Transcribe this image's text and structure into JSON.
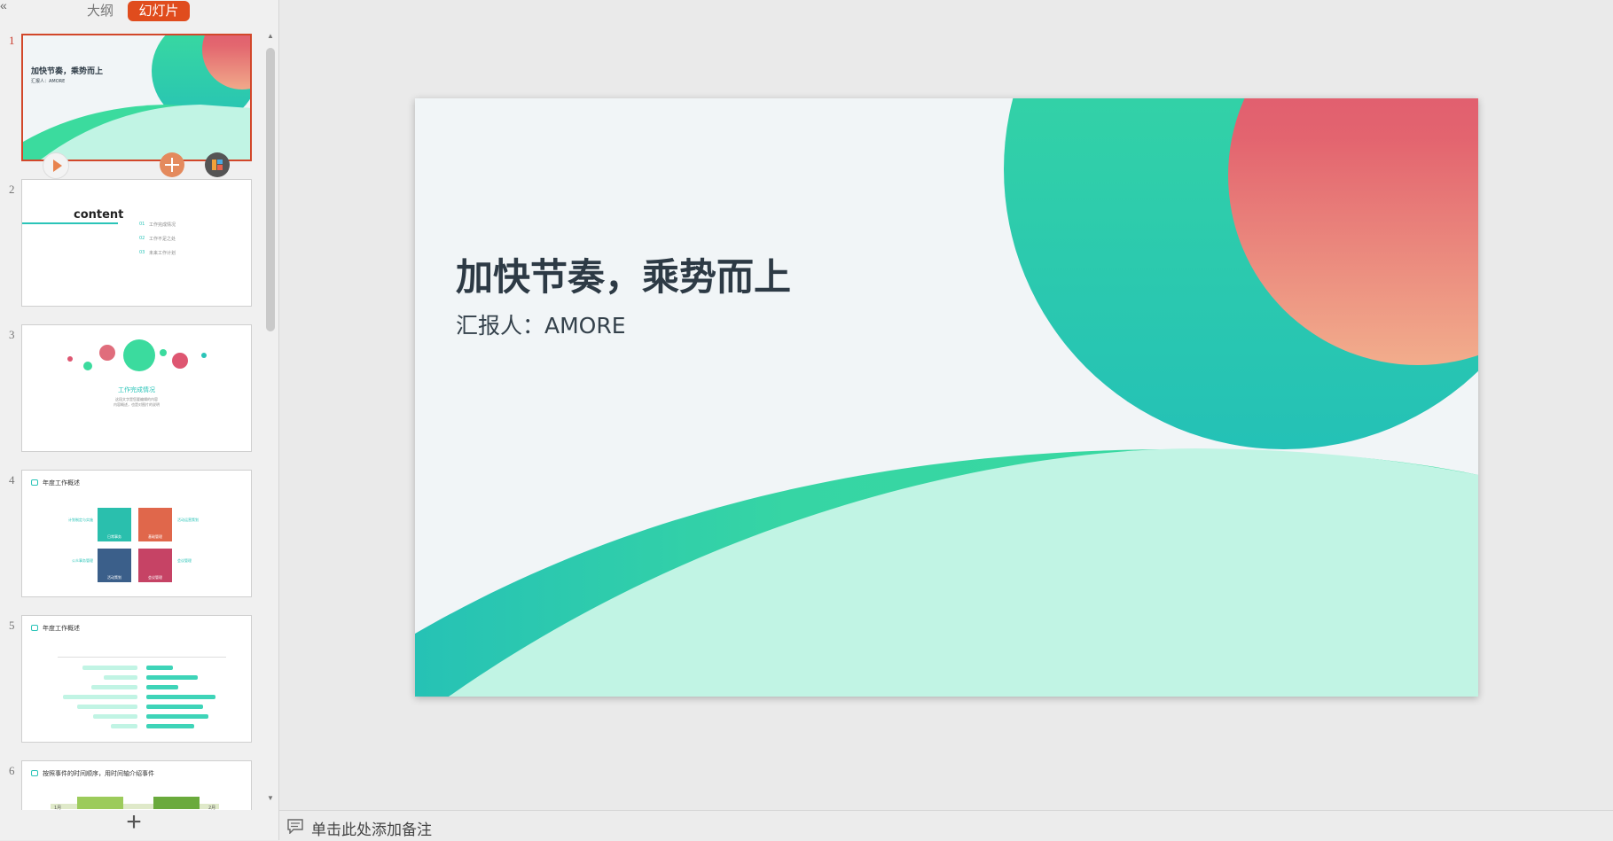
{
  "panel": {
    "collapse_icon": "double-chevron-left-icon",
    "tabs": {
      "outline": "大纲",
      "slides": "幻灯片"
    },
    "add_slide_icon": "plus-icon"
  },
  "thumbnails": [
    {
      "number": "1",
      "title": "加快节奏，乘势而上",
      "subtitle": "汇报人：AMORE"
    },
    {
      "number": "2",
      "title": "content",
      "items": [
        "工作完成情况",
        "工作不足之处",
        "未来工作计划"
      ],
      "bullets": [
        "01",
        "02",
        "03"
      ]
    },
    {
      "number": "3",
      "title": "工作完成情况",
      "text": "这段文字是您要编辑的内容",
      "text2": "内容概述，也是对图片的说明"
    },
    {
      "number": "4",
      "title": "年度工作概述",
      "tiles": [
        "日常事务",
        "基础管理",
        "活动策划",
        "会议管理"
      ],
      "labels": [
        "计划制定与实施",
        "活动运营策划",
        "公众事务管理",
        "会议管理"
      ]
    },
    {
      "number": "5",
      "title": "年度工作概述"
    },
    {
      "number": "6",
      "title": "按照事件的时间顺序，用时间轴介绍事件",
      "tags": [
        "1月",
        "2月"
      ]
    }
  ],
  "slide": {
    "title": "加快节奏，乘势而上",
    "subtitle": "汇报人：AMORE"
  },
  "notes": {
    "placeholder": "单击此处添加备注",
    "icon": "comment-icon"
  },
  "colors": {
    "accent": "#e04c1d",
    "green": "#3bdb9e",
    "teal": "#2ac4b8",
    "pink": "#de5671",
    "mint": "#c1f4e4"
  }
}
